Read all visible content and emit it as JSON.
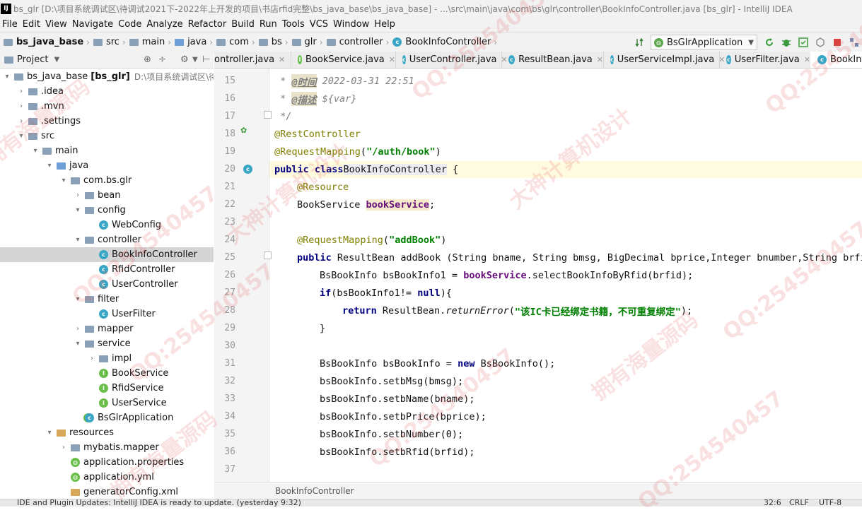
{
  "window_title": "bs_glr [D:\\项目系统调试区\\待调试2021下-2022年上开发的项目\\书店rfid完整\\bs_java_base\\bs_java_base] - ...\\src\\main\\java\\com\\bs\\glr\\controller\\BookInfoController.java [bs_glr] - IntelliJ IDEA",
  "app_logo": "IJ",
  "menu": [
    "File",
    "Edit",
    "View",
    "Navigate",
    "Code",
    "Analyze",
    "Refactor",
    "Build",
    "Run",
    "Tools",
    "VCS",
    "Window",
    "Help"
  ],
  "breadcrumbs": [
    "bs_java_base",
    "src",
    "main",
    "java",
    "com",
    "bs",
    "glr",
    "controller",
    "BookInfoController"
  ],
  "run_config": "BsGlrApplication",
  "project_panel": {
    "title": "Project"
  },
  "tree": [
    {
      "label": "bs_java_base",
      "suffix": "[bs_glr]",
      "path": "D:\\项目系统调试区\\待调试",
      "icon": "module-folder-icon",
      "arrow": "▾",
      "depth": 0
    },
    {
      "label": ".idea",
      "icon": "folder-icon",
      "arrow": "›",
      "depth": 1
    },
    {
      "label": ".mvn",
      "icon": "folder-icon",
      "arrow": "›",
      "depth": 1
    },
    {
      "label": ".settings",
      "icon": "folder-icon",
      "arrow": "›",
      "depth": 1
    },
    {
      "label": "src",
      "icon": "folder-icon",
      "arrow": "▾",
      "depth": 1
    },
    {
      "label": "main",
      "icon": "folder-icon",
      "arrow": "▾",
      "depth": 2
    },
    {
      "label": "java",
      "icon": "source-folder-icon",
      "arrow": "▾",
      "depth": 3
    },
    {
      "label": "com.bs.glr",
      "icon": "package-icon",
      "arrow": "▾",
      "depth": 4
    },
    {
      "label": "bean",
      "icon": "package-icon",
      "arrow": "›",
      "depth": 5
    },
    {
      "label": "config",
      "icon": "package-icon",
      "arrow": "▾",
      "depth": 5
    },
    {
      "label": "WebConfig",
      "icon": "class-icon",
      "arrow": "",
      "depth": 6
    },
    {
      "label": "controller",
      "icon": "package-icon",
      "arrow": "▾",
      "depth": 5
    },
    {
      "label": "BookInfoController",
      "icon": "class-icon",
      "arrow": "",
      "depth": 6,
      "selected": true
    },
    {
      "label": "RfidController",
      "icon": "class-icon",
      "arrow": "",
      "depth": 6
    },
    {
      "label": "UserController",
      "icon": "class-icon",
      "arrow": "",
      "depth": 6
    },
    {
      "label": "filter",
      "icon": "package-icon",
      "arrow": "▾",
      "depth": 5
    },
    {
      "label": "UserFilter",
      "icon": "class-icon",
      "arrow": "",
      "depth": 6
    },
    {
      "label": "mapper",
      "icon": "package-icon",
      "arrow": "›",
      "depth": 5
    },
    {
      "label": "service",
      "icon": "package-icon",
      "arrow": "▾",
      "depth": 5
    },
    {
      "label": "impl",
      "icon": "package-icon",
      "arrow": "›",
      "depth": 6
    },
    {
      "label": "BookService",
      "icon": "interface-icon",
      "arrow": "",
      "depth": 6
    },
    {
      "label": "RfidService",
      "icon": "interface-icon",
      "arrow": "",
      "depth": 6
    },
    {
      "label": "UserService",
      "icon": "interface-icon",
      "arrow": "",
      "depth": 6
    },
    {
      "label": "BsGlrApplication",
      "icon": "spring-class-icon",
      "arrow": "",
      "depth": 5
    },
    {
      "label": "resources",
      "icon": "resources-folder-icon",
      "arrow": "▾",
      "depth": 3
    },
    {
      "label": "mybatis.mapper",
      "icon": "folder-icon",
      "arrow": "›",
      "depth": 4
    },
    {
      "label": "application.properties",
      "icon": "properties-file-icon",
      "arrow": "",
      "depth": 4
    },
    {
      "label": "application.yml",
      "icon": "yml-file-icon",
      "arrow": "",
      "depth": 4
    },
    {
      "label": "generatorConfig.xml",
      "icon": "xml-file-icon",
      "arrow": "",
      "depth": 4
    }
  ],
  "tabs": [
    {
      "label": "ontroller.java",
      "icon": "class-icon"
    },
    {
      "label": "BookService.java",
      "icon": "interface-icon"
    },
    {
      "label": "UserController.java",
      "icon": "class-icon"
    },
    {
      "label": "ResultBean.java",
      "icon": "class-icon"
    },
    {
      "label": "UserServiceImpl.java",
      "icon": "class-icon"
    },
    {
      "label": "UserFilter.java",
      "icon": "class-icon"
    },
    {
      "label": "BookInfo",
      "icon": "class-icon",
      "active": true
    }
  ],
  "line_numbers": [
    "15",
    "16",
    "17",
    "18",
    "19",
    "20",
    "21",
    "22",
    "23",
    "24",
    "25",
    "26",
    "27",
    "28",
    "29",
    "30",
    "31",
    "32",
    "33",
    "34",
    "35",
    "36",
    "37"
  ],
  "code": {
    "l15_tag": "@时间",
    "l15_text": "2022-03-31 22:51",
    "l16_tag": "@描述",
    "l16_text": "${var}",
    "l17": "*/",
    "l18": "@RestController",
    "l19_ann": "@RequestMapping",
    "l19_str": "\"/auth/book\"",
    "l20_kw": "public class",
    "l20_name": "BookInfoController",
    "l20_rest": " {",
    "l21": "@Resource",
    "l22_type": "BookService ",
    "l22_fld": "bookService",
    "l22_end": ";",
    "l24_ann": "@RequestMapping",
    "l24_str": "\"addBook\"",
    "l25_kw": "public",
    "l25_rest": " ResultBean addBook (String bname, String bmsg, BigDecimal bprice,Integer bnumber,String brfid",
    "l26_a": "BsBookInfo bsBookInfo1 = ",
    "l26_fld": "bookService",
    "l26_b": ".selectBookInfoByRfid(brfid);",
    "l27_kw": "if",
    "l27_a": "(bsBookInfo1!= ",
    "l27_kw2": "null",
    "l27_b": "){",
    "l28_kw": "return",
    "l28_a": " ResultBean.",
    "l28_it": "returnError",
    "l28_str": "\"该IC卡已经绑定书籍，不可重复绑定\"",
    "l28_b": ");",
    "l29": "}",
    "l31_a": "BsBookInfo bsBookInfo = ",
    "l31_kw": "new",
    "l31_b": " BsBookInfo();",
    "l32": "bsBookInfo.setbMsg(bmsg);",
    "l33": "bsBookInfo.setbName(bname);",
    "l34": "bsBookInfo.setbPrice(bprice);",
    "l35": "bsBookInfo.setbNumber(0);",
    "l36": "bsBookInfo.setbRfid(brfid);"
  },
  "editor_breadcrumb": "BookInfoController",
  "status": {
    "left": "IDE and Plugin Updates: IntelliJ IDEA is ready to update. (yesterday 9:32)",
    "pos": "32:6",
    "sep": "CRLF",
    "enc": "UTF-8"
  },
  "watermarks": [
    "QQ:254540457",
    "大神计算机设计",
    "拥有海量源码"
  ]
}
